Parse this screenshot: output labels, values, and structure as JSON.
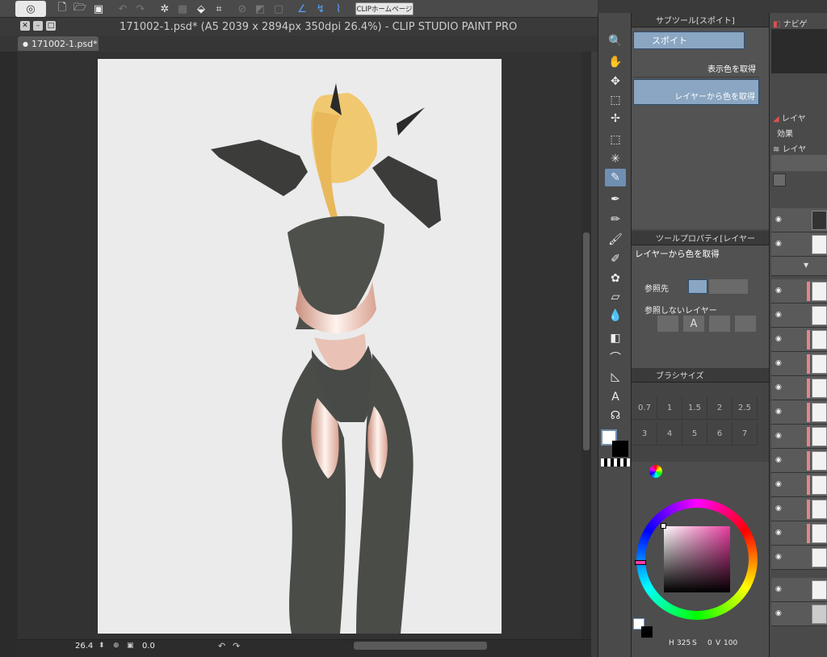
{
  "toolbar": {
    "home_label": "CLIPホームページ"
  },
  "window": {
    "title": "171002-1.psd* (A5 2039 x 2894px 350dpi 26.4%) - CLIP STUDIO PAINT PRO",
    "tab_label": "171002-1.psd*"
  },
  "statusbar": {
    "zoom": "26.4",
    "angle": "0.0"
  },
  "subtool": {
    "header": "サブツール[スポイト]",
    "tab": "スポイト",
    "items": [
      "表示色を取得",
      "レイヤーから色を取得"
    ]
  },
  "tool_property": {
    "header": "ツールプロパティ[レイヤー",
    "name": "レイヤーから色を取得",
    "reference_label": "参照先",
    "exclude_label": "参照しないレイヤー"
  },
  "brush_size": {
    "header": "ブラシサイズ",
    "sizes": [
      "0.7",
      "1",
      "1.5",
      "2",
      "2.5",
      "3",
      "4",
      "5",
      "6",
      "7"
    ]
  },
  "color": {
    "h": "325",
    "s": "0",
    "v": "100",
    "hue_ring_colors": [
      "#ff0000",
      "#ffff00",
      "#00ff00",
      "#00ffff",
      "#0000ff",
      "#ff00ff",
      "#ff0000"
    ],
    "sv_base": "#e83ca0"
  },
  "right_panel": {
    "nav_header": "ナビゲ",
    "layer_header": "レイヤ",
    "effect_label": "効果",
    "layer_header2": "レイヤ"
  },
  "colors": {
    "accent": "#8aa6c2",
    "layer_marker": "#e0868a"
  }
}
